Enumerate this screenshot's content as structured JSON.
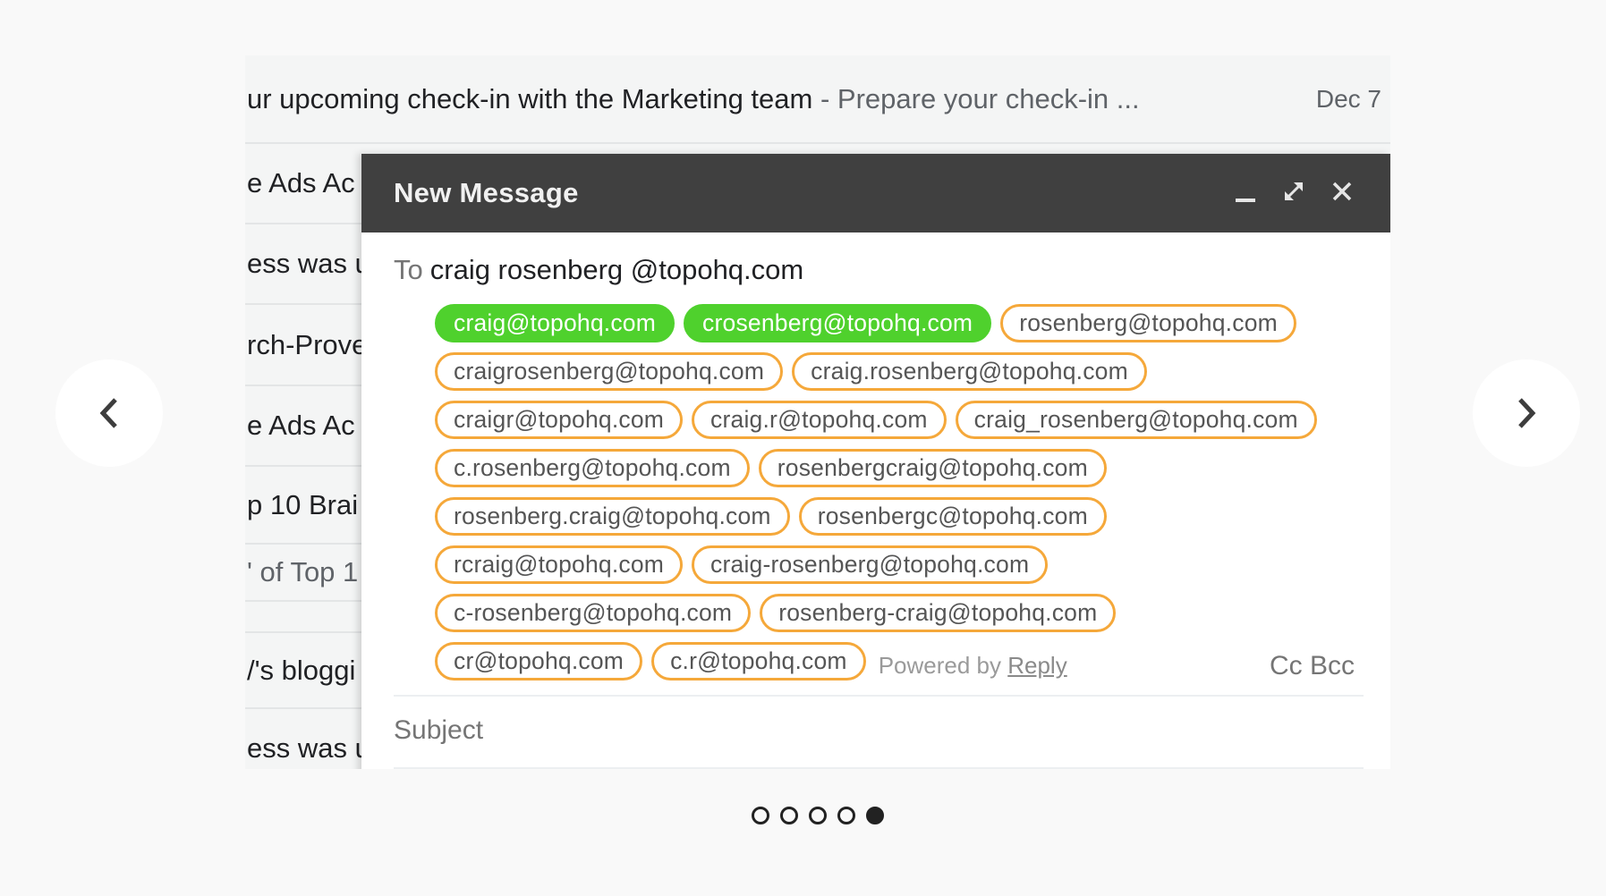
{
  "carousel": {
    "prev_icon": "chevron-left-icon",
    "next_icon": "chevron-right-icon",
    "slide_count": 5,
    "active_slide": 5
  },
  "inbox": {
    "rows": [
      {
        "subject": "ur upcoming check-in with the Marketing team",
        "snippet": " - Prepare your check-in ...",
        "date": "Dec 7"
      },
      {
        "subject": "e Ads Ac"
      },
      {
        "subject": "ess was u"
      },
      {
        "subject": "rch-Prove"
      },
      {
        "subject": "e Ads Ac"
      },
      {
        "subject": "p 10 Brai"
      },
      {
        "subject": "' of Top 1"
      },
      {
        "subject": ""
      },
      {
        "subject": "/'s bloggi"
      },
      {
        "subject": "ess was u"
      }
    ]
  },
  "compose": {
    "title": "New Message",
    "header_icons": [
      "minimize-icon",
      "expand-icon",
      "close-icon"
    ],
    "to_label": "To",
    "to_value": "craig rosenberg @topohq.com",
    "suggestions": [
      [
        {
          "email": "craig@topohq.com",
          "status": "valid"
        },
        {
          "email": "crosenberg@topohq.com",
          "status": "valid"
        },
        {
          "email": "rosenberg@topohq.com",
          "status": "unverified"
        }
      ],
      [
        {
          "email": "craigrosenberg@topohq.com",
          "status": "unverified"
        },
        {
          "email": "craig.rosenberg@topohq.com",
          "status": "unverified"
        }
      ],
      [
        {
          "email": "craigr@topohq.com",
          "status": "unverified"
        },
        {
          "email": "craig.r@topohq.com",
          "status": "unverified"
        },
        {
          "email": "craig_rosenberg@topohq.com",
          "status": "unverified"
        }
      ],
      [
        {
          "email": "c.rosenberg@topohq.com",
          "status": "unverified"
        },
        {
          "email": "rosenbergcraig@topohq.com",
          "status": "unverified"
        }
      ],
      [
        {
          "email": "rosenberg.craig@topohq.com",
          "status": "unverified"
        },
        {
          "email": "rosenbergc@topohq.com",
          "status": "unverified"
        }
      ],
      [
        {
          "email": "rcraig@topohq.com",
          "status": "unverified"
        },
        {
          "email": "craig-rosenberg@topohq.com",
          "status": "unverified"
        }
      ],
      [
        {
          "email": "c-rosenberg@topohq.com",
          "status": "unverified"
        },
        {
          "email": "rosenberg-craig@topohq.com",
          "status": "unverified"
        }
      ],
      [
        {
          "email": "cr@topohq.com",
          "status": "unverified"
        },
        {
          "email": "c.r@topohq.com",
          "status": "unverified"
        }
      ]
    ],
    "powered_by": "Powered by ",
    "powered_link": "Reply",
    "cc_bcc": "Cc Bcc",
    "subject_placeholder": "Subject"
  },
  "colors": {
    "valid_chip": "#4fd12d",
    "unverified_border": "#f5a83a",
    "header_bg": "#404040"
  }
}
